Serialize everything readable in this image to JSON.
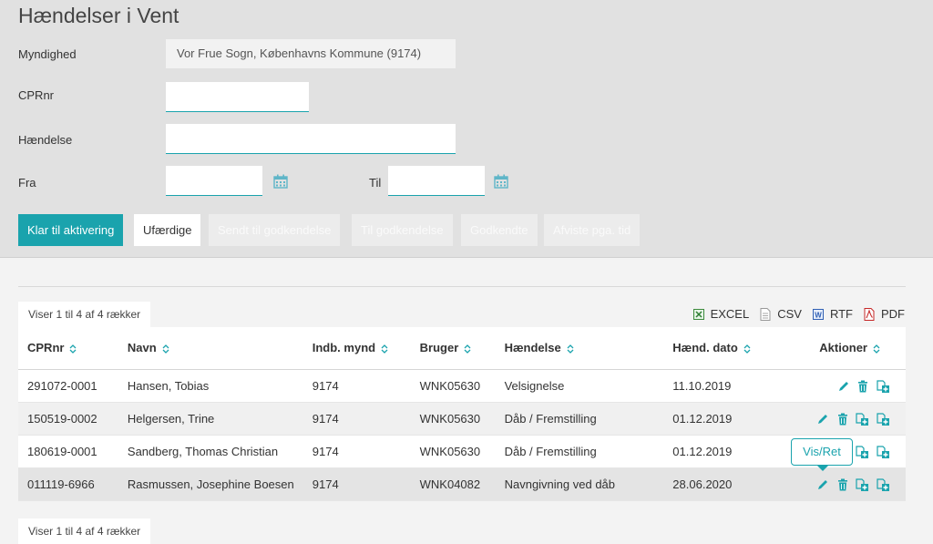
{
  "page": {
    "title": "Hændelser i Vent"
  },
  "form": {
    "myndighed_label": "Myndighed",
    "myndighed_value": "Vor Frue Sogn, Københavns Kommune (9174)",
    "cprnr_label": "CPRnr",
    "cprnr_value": "",
    "haendelse_label": "Hændelse",
    "haendelse_value": "",
    "fra_label": "Fra",
    "fra_value": "",
    "til_label": "Til",
    "til_value": ""
  },
  "filters": [
    {
      "label": "Klar til aktivering",
      "state": "active"
    },
    {
      "label": "Ufærdige",
      "state": "normal"
    },
    {
      "label": "Sendt til godkendelse",
      "state": "disabled"
    },
    {
      "label": "Til godkendelse",
      "state": "disabled"
    },
    {
      "label": "Godkendte",
      "state": "disabled"
    },
    {
      "label": "Afviste pga. tid",
      "state": "disabled"
    }
  ],
  "pager": {
    "info_top": "Viser 1 til 4 af 4 rækker",
    "info_bottom": "Viser 1 til 4 af 4 rækker"
  },
  "export": {
    "excel": "EXCEL",
    "csv": "CSV",
    "rtf": "RTF",
    "pdf": "PDF"
  },
  "table": {
    "headers": {
      "cprnr": "CPRnr",
      "navn": "Navn",
      "indb": "Indb. mynd",
      "bruger": "Bruger",
      "haendelse": "Hændelse",
      "dato": "Hænd. dato",
      "aktioner": "Aktioner"
    },
    "rows": [
      {
        "cprnr": "291072-0001",
        "navn": "Hansen, Tobias",
        "indb": "9174",
        "bruger": "WNK05630",
        "haendelse": "Velsignelse",
        "dato": "11.10.2019"
      },
      {
        "cprnr": "150519-0002",
        "navn": "Helgersen, Trine",
        "indb": "9174",
        "bruger": "WNK05630",
        "haendelse": "Dåb / Fremstilling",
        "dato": "01.12.2019"
      },
      {
        "cprnr": "180619-0001",
        "navn": "Sandberg, Thomas Christian",
        "indb": "9174",
        "bruger": "WNK05630",
        "haendelse": "Dåb / Fremstilling",
        "dato": "01.12.2019"
      },
      {
        "cprnr": "011119-6966",
        "navn": "Rasmussen, Josephine Boesen",
        "indb": "9174",
        "bruger": "WNK04082",
        "haendelse": "Navngivning ved dåb",
        "dato": "28.06.2020"
      }
    ]
  },
  "tooltip": {
    "label": "Vis/Ret"
  },
  "colors": {
    "accent": "#1aa3ad",
    "panel": "#e1e1e1",
    "background": "#f3f3f3"
  }
}
